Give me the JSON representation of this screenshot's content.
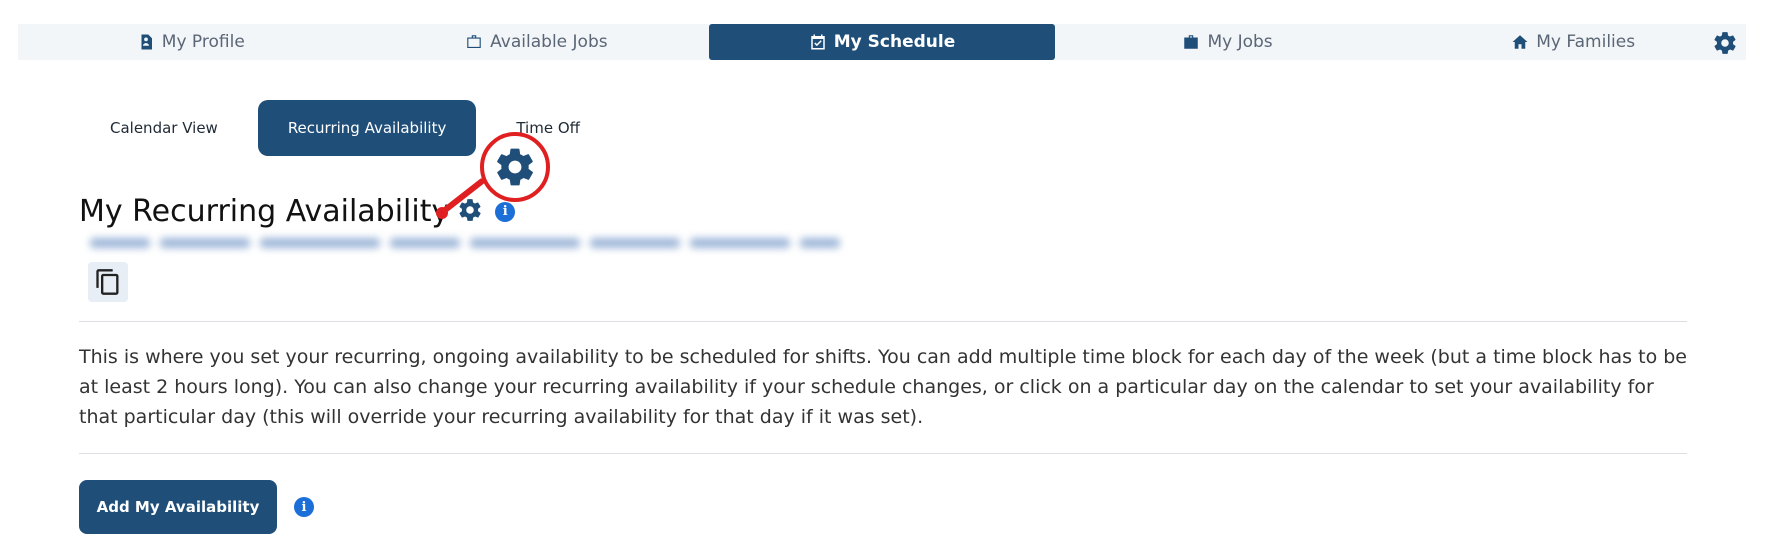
{
  "nav": {
    "items": [
      {
        "label": "My Profile",
        "icon": "profile-icon"
      },
      {
        "label": "Available Jobs",
        "icon": "briefcase-outline-icon"
      },
      {
        "label": "My Schedule",
        "icon": "calendar-check-icon",
        "active": true
      },
      {
        "label": "My Jobs",
        "icon": "briefcase-icon"
      },
      {
        "label": "My Families",
        "icon": "home-icon"
      }
    ],
    "settings_icon": "gear-icon"
  },
  "subtabs": [
    {
      "label": "Calendar View"
    },
    {
      "label": "Recurring Availability",
      "active": true
    },
    {
      "label": "Time Off"
    }
  ],
  "page": {
    "title": "My Recurring Availability",
    "title_icons": [
      "gear-icon",
      "info-icon"
    ],
    "info_glyph": "i",
    "description": "This is where you set your recurring, ongoing availability to be scheduled for shifts. You can add multiple time block for each day of the week (but a time block has to be at least 2 hours long). You can also change your recurring availability if your schedule changes, or click on a particular day on the calendar to set your availability for that particular day (this will override your recurring availability for that day if it was set).",
    "add_button_label": "Add My Availability"
  },
  "colors": {
    "primary": "#1f4e78",
    "info": "#1d6fd8",
    "callout": "#e02020"
  }
}
